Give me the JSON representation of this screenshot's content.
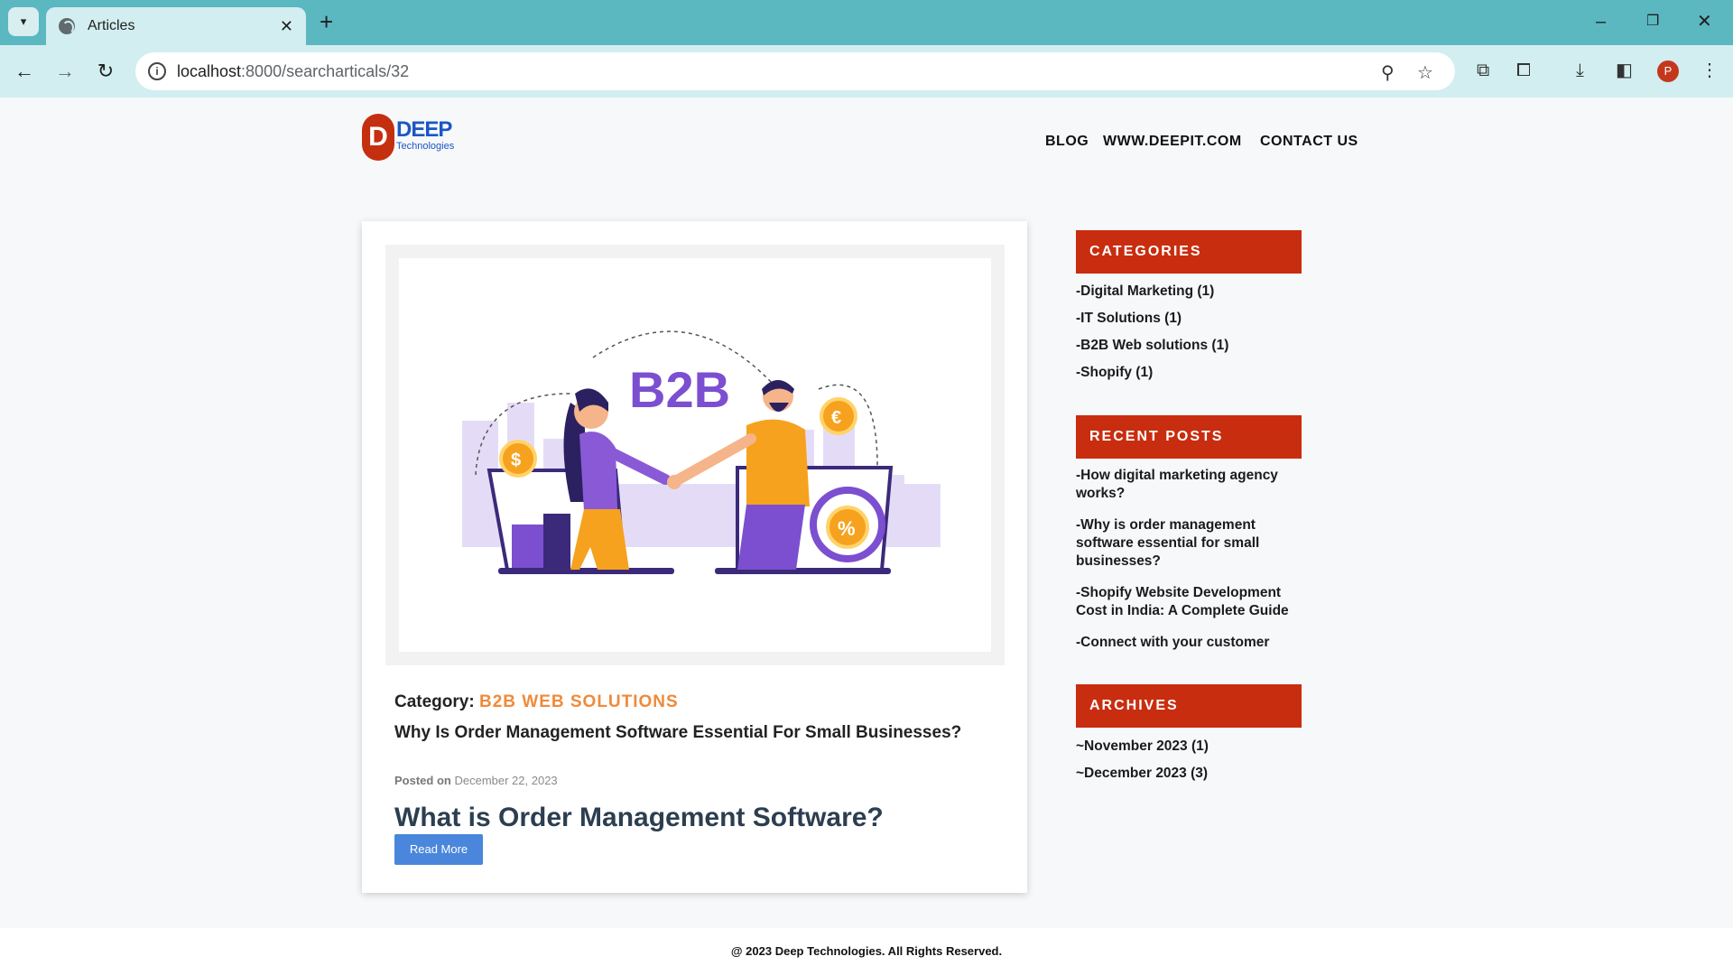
{
  "browser": {
    "tab_title": "Articles",
    "url_host": "localhost",
    "url_path": ":8000/searcharticals/32",
    "profile_initial": "P",
    "icons": [
      "tab-menu-icon",
      "globe-icon",
      "close-icon",
      "plus-icon",
      "back-icon",
      "forward-icon",
      "reload-icon",
      "info-icon",
      "zoom-icon",
      "star-icon",
      "tab-search-icon",
      "extensions-icon",
      "download-icon",
      "sidebar-icon",
      "menu-icon",
      "minimize-icon",
      "restore-icon",
      "window-close-icon"
    ]
  },
  "site": {
    "logo_letter": "D",
    "logo_name": "DEEP",
    "logo_sub": "Technologies",
    "nav": [
      "BLOG",
      "WWW.DEEPIT.COM",
      "CONTACT US"
    ]
  },
  "article": {
    "image_text": "B2B",
    "category_label": "Category:",
    "category_value": "B2B WEB SOLUTIONS",
    "title": "Why Is Order Management Software Essential For Small Businesses?",
    "posted_label": "Posted on",
    "posted_date": "December 22, 2023",
    "excerpt": "What is Order Management Software?",
    "read_more": "Read More"
  },
  "sidebar": {
    "categories_title": "CATEGORIES",
    "categories": [
      "-Digital Marketing (1)",
      "-IT Solutions (1)",
      "-B2B Web solutions (1)",
      "-Shopify (1)"
    ],
    "recent_title": "RECENT POSTS",
    "recent": [
      "-How digital marketing agency works?",
      "-Why is order management software essential for small businesses?",
      "-Shopify Website Development Cost in India: A Complete Guide",
      "-Connect with your customer"
    ],
    "archives_title": "ARCHIVES",
    "archives": [
      "~November 2023 (1)",
      "~December 2023 (3)"
    ]
  },
  "footer": {
    "text": "@ 2023 Deep Technologies. All Rights Reserved."
  },
  "colors": {
    "chrome_tabbar": "#5bb8c1",
    "chrome_toolbar": "#d2eef0",
    "accent_red": "#c92d0f",
    "category_orange": "#ef8a3a",
    "button_blue": "#4a86dc",
    "illustration_purple": "#7b4fd0"
  }
}
